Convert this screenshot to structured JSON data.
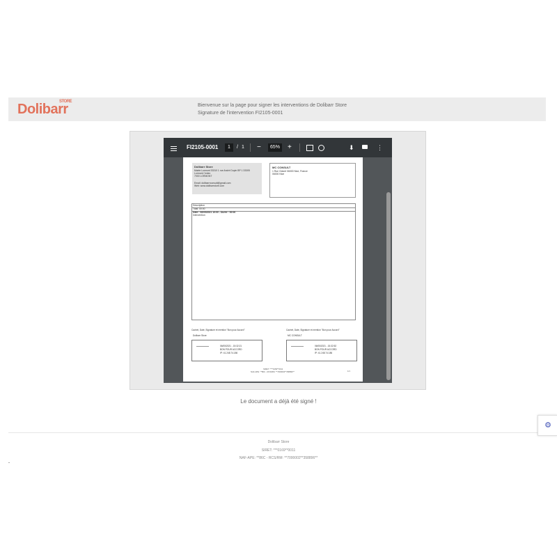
{
  "header": {
    "logo_text": "Dolibarr",
    "logo_tag": "STORE",
    "welcome_line": "Bienvenue sur la page pour signer les interventions de Dolibarr Store",
    "signature_line": "Signature de l'intervention FI2105-0001",
    "brand_color": "#e2725b"
  },
  "viewer": {
    "title": "FI2105-0001",
    "current_page": "1",
    "page_sep": "/",
    "total_pages": "1",
    "zoom_minus": "−",
    "zoom": "65%",
    "zoom_plus": "+",
    "icons": [
      "menu-icon",
      "fit-page-icon",
      "rotate-icon",
      "download-icon",
      "print-icon",
      "more-icon"
    ],
    "download_glyph": "⬇",
    "more_glyph": "⋮"
  },
  "document": {
    "emitter": {
      "name": "Dolibarr Store",
      "lines": [
        "Mairie Lormont 33310 1 rue André Dupin BP 1 33305",
        "Lormont Cedex",
        "7000 LORMONT",
        "",
        "Email: dolibarrrconsult@gmail.com",
        "Web: www.dolibarrstore.com"
      ]
    },
    "recipient": {
      "name": "MC CONSULT",
      "lines": [
        "1 Rue Odoné 06000 Nice, France",
        "06000 Nice"
      ]
    },
    "table": {
      "header": "Description",
      "total": "Total: 00:00",
      "date_line": "Date : 06/05/2021 10:00 - Durée : 00:00",
      "item": "Intervention"
    },
    "signatures": [
      {
        "label": "Cachet, Date, Signature et mention \"Bon pour Accord\"",
        "owner": "Dolibarr Store",
        "lines": [
          "06/05/2021 - 15:32:21",
          "BON POUR ACCORD",
          "IP: 41.248.74.186"
        ]
      },
      {
        "label": "Cachet, Date, Signature et mention \"Bon pour Accord\"",
        "owner": "MC CONSULT",
        "lines": [
          "06/05/2021 - 15:32:52",
          "BON POUR ACCORD",
          "IP: 41.248.74.186"
        ]
      }
    ],
    "page_footer": [
      "SIRET: ****0169**0011",
      "NAF-APE: **86C - RCS/RM: **7000002**358896**"
    ],
    "page_number": "1/1"
  },
  "status_message": "Le document a déjà été signé !",
  "footer": {
    "company": "Dolibarr Store",
    "siret": "SIRET: ***0169**0011",
    "naf": "NAF-APE: **86C - RCS/RM: **7000002**358896**"
  },
  "gear_glyph": "⚙",
  "accent_color": "#3f51b5"
}
